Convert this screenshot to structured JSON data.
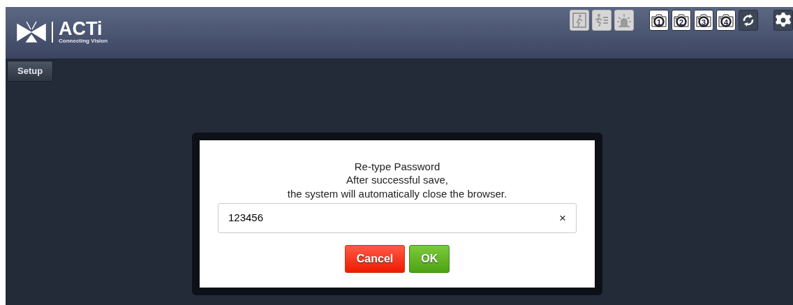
{
  "header": {
    "logo": "ACTi",
    "tagline": "Connecting Vision"
  },
  "toolbar": [
    {
      "kind": "door",
      "disabled": true
    },
    {
      "kind": "running",
      "disabled": true
    },
    {
      "kind": "siren",
      "disabled": true
    },
    {
      "kind": "snapshot",
      "label": "1",
      "disabled": false
    },
    {
      "kind": "snapshot",
      "label": "2",
      "disabled": false
    },
    {
      "kind": "snapshot",
      "label": "3",
      "disabled": false
    },
    {
      "kind": "snapshot",
      "label": "4",
      "disabled": false
    },
    {
      "kind": "refresh",
      "disabled": false
    },
    {
      "kind": "settings",
      "disabled": false
    }
  ],
  "tabs": [
    {
      "label": "Setup"
    }
  ],
  "dialog": {
    "lines": [
      "Re-type Password",
      "After successful save,",
      "the system will automatically close the browser."
    ],
    "field": {
      "value": "123456",
      "clear": "×"
    },
    "buttons": [
      {
        "label": "Cancel",
        "kind": "danger"
      },
      {
        "label": "OK",
        "kind": "confirm"
      }
    ]
  }
}
